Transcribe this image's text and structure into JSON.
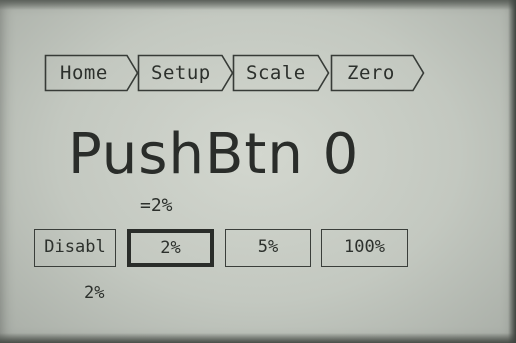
{
  "breadcrumb": {
    "items": [
      {
        "label": "Home"
      },
      {
        "label": "Setup"
      },
      {
        "label": "Scale"
      },
      {
        "label": "Zero"
      }
    ]
  },
  "title": "PushBtn 0",
  "current_value": "=2%",
  "buttons": [
    {
      "label": "Disabl",
      "selected": false
    },
    {
      "label": "2%",
      "selected": true
    },
    {
      "label": "5%",
      "selected": false
    },
    {
      "label": "100%",
      "selected": false
    }
  ],
  "status_value": "2%"
}
